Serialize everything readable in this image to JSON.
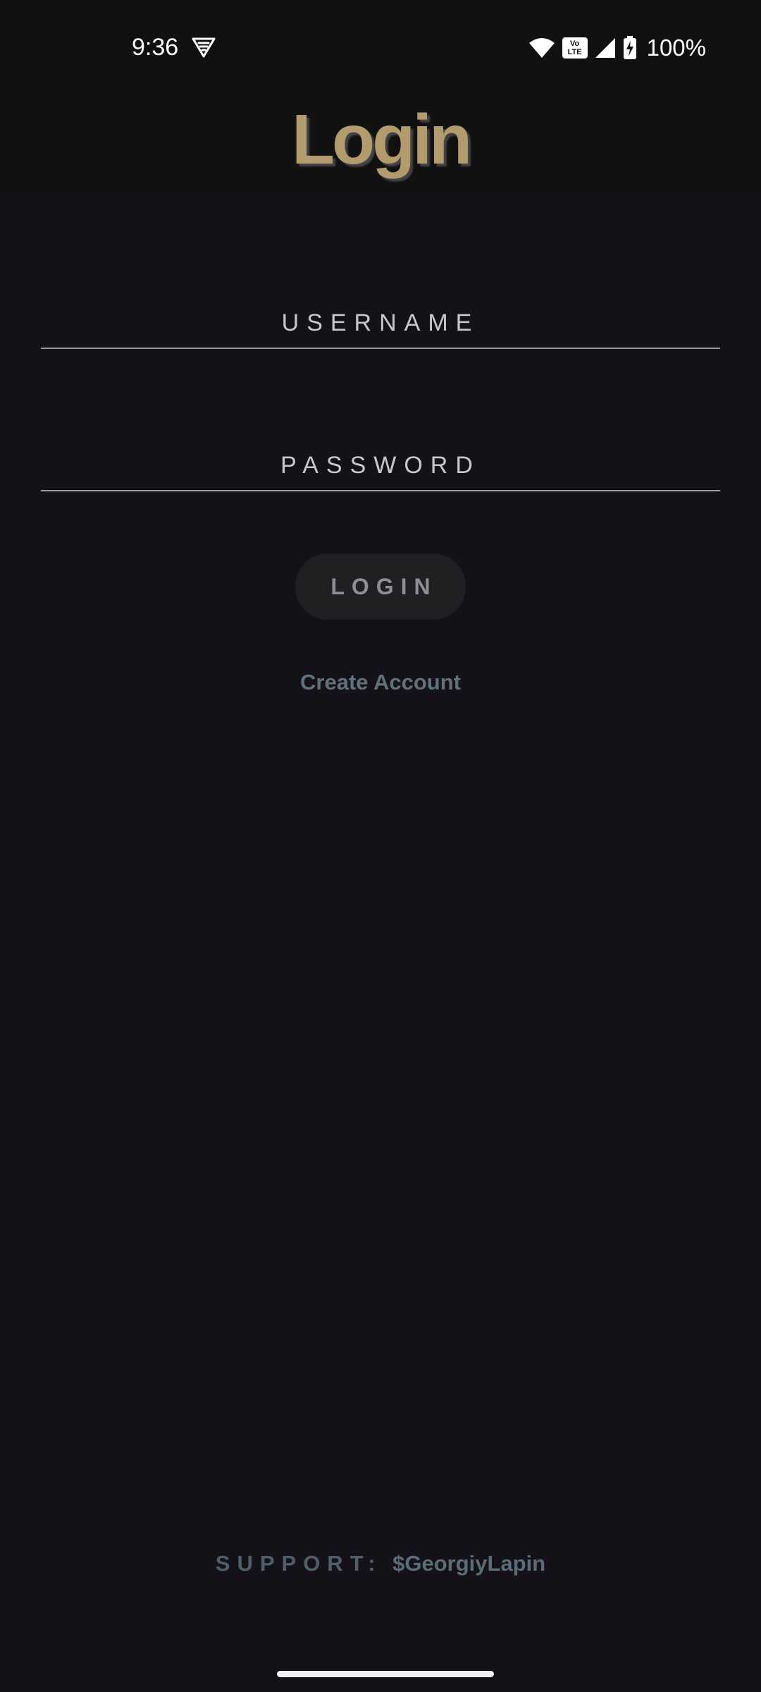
{
  "status_bar": {
    "time": "9:36",
    "vpn_icon": "vpn-shield-icon",
    "wifi_icon": "wifi-icon",
    "volte_label_top": "Vo",
    "volte_label_bottom": "LTE",
    "signal_icon": "cellular-signal-icon",
    "battery_icon": "battery-charging-icon",
    "battery_percent": "100%"
  },
  "header": {
    "title": "Login",
    "title_color": "#b29c6e",
    "background": "#111111"
  },
  "form": {
    "username": {
      "placeholder": "USERNAME",
      "value": ""
    },
    "password": {
      "placeholder": "PASSWORD",
      "value": ""
    },
    "login_button_label": "LOGIN",
    "create_account_label": "Create Account"
  },
  "footer": {
    "support_label": "SUPPORT:",
    "support_handle": "$GeorgiyLapin"
  },
  "colors": {
    "background": "#141218",
    "accent_link": "#61707a",
    "button_background": "#202022"
  }
}
